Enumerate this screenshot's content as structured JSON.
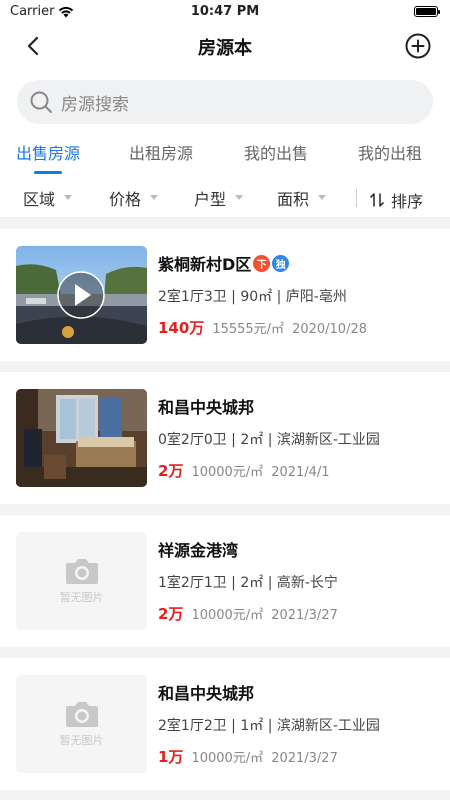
{
  "status": {
    "carrier": "Carrier",
    "time": "10:47 PM"
  },
  "nav": {
    "title": "房源本"
  },
  "search": {
    "placeholder": "房源搜索"
  },
  "tabs": [
    "出售房源",
    "出租房源",
    "我的出售",
    "我的出租"
  ],
  "filters": [
    "区域",
    "价格",
    "户型",
    "面积"
  ],
  "sort_label": "排序",
  "listings": [
    {
      "name": "紫桐新村D区",
      "tags": [
        "下",
        "独"
      ],
      "detail": "2室1厅3卫 | 90㎡ | 庐阳-亳州",
      "price": "140万",
      "unit_price": "15555元/㎡",
      "date": "2020/10/28",
      "thumb": "video"
    },
    {
      "name": "和昌中央城邦",
      "tags": [],
      "detail": "0室2厅0卫 | 2㎡ | 滨湖新区-工业园",
      "price": "2万",
      "unit_price": "10000元/㎡",
      "date": "2021/4/1",
      "thumb": "photo"
    },
    {
      "name": "祥源金港湾",
      "tags": [],
      "detail": "1室2厅1卫 | 2㎡ | 高新-长宁",
      "price": "2万",
      "unit_price": "10000元/㎡",
      "date": "2021/3/27",
      "thumb": "none"
    },
    {
      "name": "和昌中央城邦",
      "tags": [],
      "detail": "2室1厅2卫 | 1㎡ | 滨湖新区-工业园",
      "price": "1万",
      "unit_price": "10000元/㎡",
      "date": "2021/3/27",
      "thumb": "none"
    }
  ],
  "no_photo_text": "暂无图片",
  "colors": {
    "accent": "#1677e8",
    "price": "#e5201e",
    "tag_orange": "#f0522e",
    "tag_blue": "#2e86ef"
  }
}
